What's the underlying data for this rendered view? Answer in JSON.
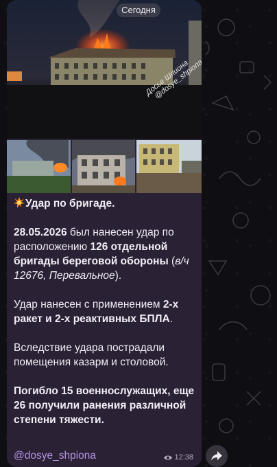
{
  "date_label": "Сегодня",
  "watermark": {
    "line1": "Досье Шпиона",
    "line2": "@dosye_shpiona"
  },
  "message": {
    "headline": "Удар по бригаде.",
    "p1_date": "28.05.2026",
    "p1_text1": " был нанесен удар по расположению ",
    "p1_bold": "126 отдельной бригады береговой обороны",
    "p1_text2": " (",
    "p1_italic": "в/ч 12676, Перевальное",
    "p1_text3": ").",
    "p2_text1": "Удар нанесен с применением ",
    "p2_bold1": "2-х ракет и 2-х реактивных БПЛА",
    "p2_text2": ".",
    "p3_text": "Вследствие удара пострадали помещения казарм и столовой.",
    "p4_bold": "Погибло 15 военнослужащих, еще 26 получили ранения различной степени тяжести.",
    "link": "@dosye_shpiona",
    "time": "12:38",
    "icons": {
      "headline_icon": "explosion-emoji",
      "views": "eye-icon",
      "forward": "share-arrow-icon"
    }
  }
}
